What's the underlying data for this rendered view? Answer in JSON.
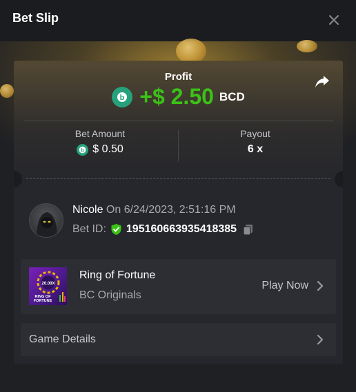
{
  "header": {
    "title": "Bet Slip"
  },
  "profit": {
    "label": "Profit",
    "value": "+$ 2.50",
    "currency": "BCD",
    "coin_icon": "bcd-coin-icon",
    "value_color": "#3bc117"
  },
  "bet_amount": {
    "label": "Bet Amount",
    "value": "$ 0.50"
  },
  "payout": {
    "label": "Payout",
    "value": "6 x"
  },
  "user": {
    "name": "Nicole",
    "date": "On 6/24/2023, 2:51:16 PM",
    "bet_id_label": "Bet ID:",
    "bet_id": "195160663935418385"
  },
  "game": {
    "title": "Ring of Fortune",
    "provider": "BC Originals",
    "play_label": "Play Now",
    "thumb_text": "RING OF FORTUNE",
    "thumb_multiplier": "20.00X"
  },
  "details": {
    "label": "Game Details"
  },
  "colors": {
    "background": "#1f2024",
    "card": "#26272c",
    "row": "#2d2e33",
    "accent_green": "#3bc117",
    "coin_teal": "#26a17b"
  }
}
